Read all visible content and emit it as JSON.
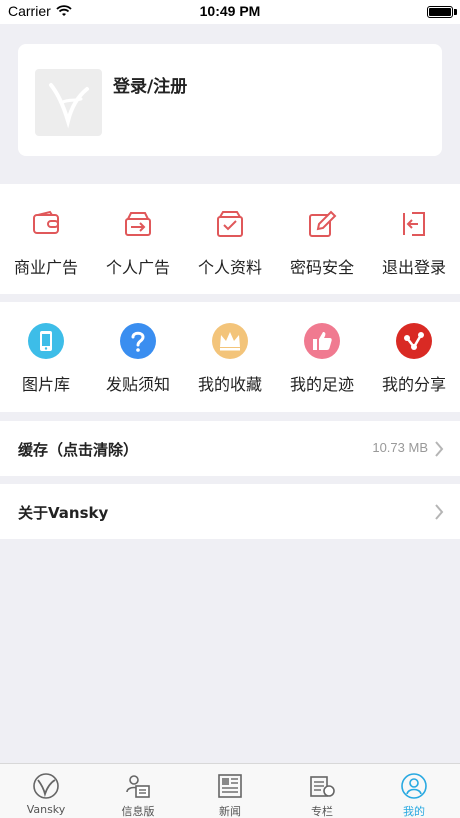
{
  "status_bar": {
    "carrier": "Carrier",
    "time": "10:49 PM"
  },
  "profile": {
    "login_label": "登录/注册"
  },
  "section_a": [
    {
      "label": "商业广告",
      "icon": "wallet-icon"
    },
    {
      "label": "个人广告",
      "icon": "inbox-arrow-icon"
    },
    {
      "label": "个人资料",
      "icon": "box-check-icon"
    },
    {
      "label": "密码安全",
      "icon": "edit-pen-icon"
    },
    {
      "label": "退出登录",
      "icon": "logout-icon"
    }
  ],
  "section_b": [
    {
      "label": "图片库",
      "icon": "phone-icon",
      "color": "#3dbde8"
    },
    {
      "label": "发贴须知",
      "icon": "question-icon",
      "color": "#3a8ef0"
    },
    {
      "label": "我的收藏",
      "icon": "crown-icon",
      "color": "#f3c47a"
    },
    {
      "label": "我的足迹",
      "icon": "thumbs-up-icon",
      "color": "#f07a90"
    },
    {
      "label": "我的分享",
      "icon": "share-icon",
      "color": "#d92a24"
    }
  ],
  "cache_row": {
    "label": "缓存（点击清除）",
    "value": "10.73 MB"
  },
  "about_row": {
    "label": "关于Vansky"
  },
  "tab_bar": [
    {
      "label": "Vansky",
      "icon": "vansky-logo-icon"
    },
    {
      "label": "信息版",
      "icon": "info-board-icon"
    },
    {
      "label": "新闻",
      "icon": "newspaper-icon"
    },
    {
      "label": "专栏",
      "icon": "column-icon"
    },
    {
      "label": "我的",
      "icon": "user-icon",
      "active": true
    }
  ],
  "colors": {
    "accent_red": "#e0585a",
    "tab_active": "#29a9e1",
    "background": "#efeff4"
  }
}
